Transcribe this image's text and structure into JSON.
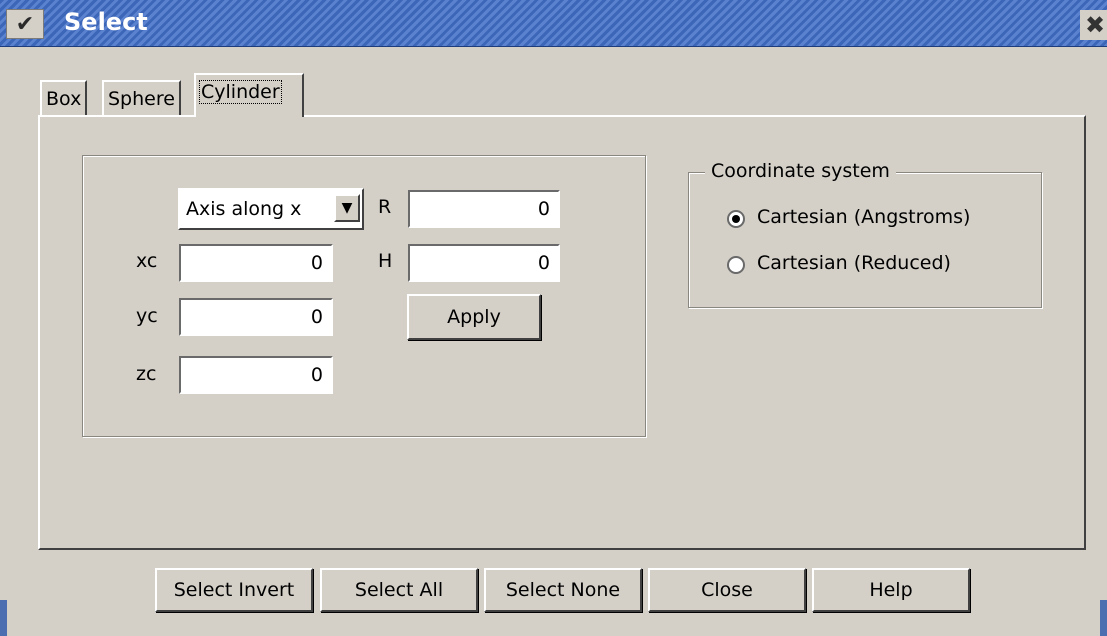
{
  "window": {
    "title": "Select"
  },
  "tabs": [
    {
      "label": "Box",
      "active": false
    },
    {
      "label": "Sphere",
      "active": false
    },
    {
      "label": "Cylinder",
      "active": true
    }
  ],
  "cylinder": {
    "axis_select": {
      "selected": "Axis along x"
    },
    "xc": {
      "label": "xc",
      "value": "0"
    },
    "yc": {
      "label": "yc",
      "value": "0"
    },
    "zc": {
      "label": "zc",
      "value": "0"
    },
    "R": {
      "label": "R",
      "value": "0"
    },
    "H": {
      "label": "H",
      "value": "0"
    },
    "apply_label": "Apply"
  },
  "coordinate_system": {
    "legend": "Coordinate system",
    "options": [
      {
        "label": "Cartesian (Angstroms)",
        "selected": true
      },
      {
        "label": "Cartesian (Reduced)",
        "selected": false
      }
    ]
  },
  "footer": {
    "select_invert": "Select Invert",
    "select_all": "Select All",
    "select_none": "Select None",
    "close": "Close",
    "help": "Help"
  },
  "colors": {
    "titlebar": "#3c66b8",
    "background": "#d4d0c8",
    "title_text": "#ffffff"
  },
  "icons": {
    "window_menu": "chevron-down-icon",
    "window_close": "close-icon",
    "combo_arrow": "triangle-down-icon"
  }
}
